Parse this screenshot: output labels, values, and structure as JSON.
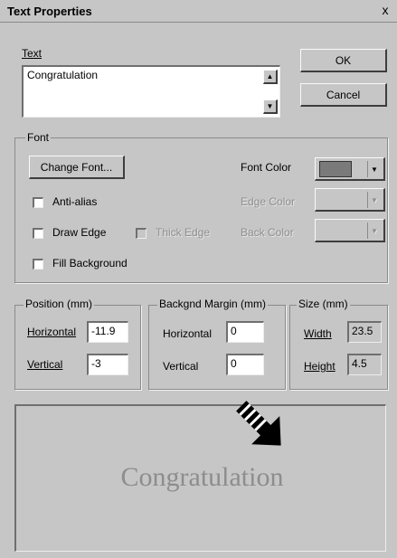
{
  "window": {
    "title": "Text Properties",
    "close": "x"
  },
  "text_field": {
    "label": "Text",
    "value": "Congratulation"
  },
  "buttons": {
    "ok": "OK",
    "cancel": "Cancel"
  },
  "font_group": {
    "legend": "Font",
    "change_font": "Change Font...",
    "font_color_label": "Font Color",
    "font_color": "#7a7a7a",
    "edge_color_label": "Edge Color",
    "back_color_label": "Back Color",
    "checkboxes": {
      "anti_alias": "Anti-alias",
      "draw_edge": "Draw Edge",
      "thick_edge": "Thick Edge",
      "fill_background": "Fill Background"
    }
  },
  "position_group": {
    "legend": "Position (mm)",
    "horizontal_label": "Horizontal",
    "horizontal": "-11.9",
    "vertical_label": "Vertical",
    "vertical": "-3"
  },
  "margin_group": {
    "legend": "Backgnd Margin (mm)",
    "horizontal_label": "Horizontal",
    "horizontal": "0",
    "vertical_label": "Vertical",
    "vertical": "0"
  },
  "size_group": {
    "legend": "Size (mm)",
    "width_label": "Width",
    "width": "23.5",
    "height_label": "Height",
    "height": "4.5"
  },
  "preview": {
    "text": "Congratulation"
  }
}
